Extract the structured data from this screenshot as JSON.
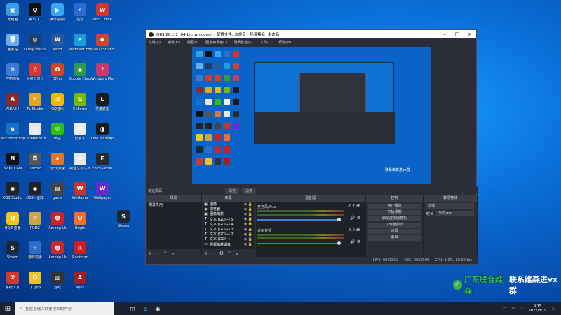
{
  "desktop_icons": [
    {
      "label": "此电脑",
      "color": "#3a9de0",
      "glyph": "▣"
    },
    {
      "label": "腾讯QQ",
      "color": "#111111",
      "glyph": "Q"
    },
    {
      "label": "腾讯视频",
      "color": "#39a6f5",
      "glyph": "▶"
    },
    {
      "label": "迅雷",
      "color": "#2c6bd6",
      "glyph": "⚡"
    },
    {
      "label": "WPS Office",
      "color": "#d8322c",
      "glyph": "W"
    },
    {
      "label": "回收站",
      "color": "#6aaee6",
      "glyph": "🗑"
    },
    {
      "label": "Lively Wallpaper",
      "color": "#223b6a",
      "glyph": "◎"
    },
    {
      "label": "Word",
      "color": "#2b579a",
      "glyph": "W"
    },
    {
      "label": "Microsoft Edge",
      "color": "#1a9dd9",
      "glyph": "e"
    },
    {
      "label": "Visual Studio",
      "color": "#d6402c",
      "glyph": "◆"
    },
    {
      "label": "控制面板",
      "color": "#3e7ad0",
      "glyph": "⚙"
    },
    {
      "label": "网易云音乐",
      "color": "#d33a31",
      "glyph": "♫"
    },
    {
      "label": "Office",
      "color": "#d0452a",
      "glyph": "O"
    },
    {
      "label": "Google Chrome",
      "color": "#2e9a4a",
      "glyph": "◉"
    },
    {
      "label": "Windows Media",
      "color": "#c73a6a",
      "glyph": "♪"
    },
    {
      "label": "AIDA64",
      "color": "#8a2a2a",
      "glyph": "A"
    },
    {
      "label": "FL Studio",
      "color": "#e3a623",
      "glyph": "F"
    },
    {
      "label": "QQ音乐",
      "color": "#f2b705",
      "glyph": "♬"
    },
    {
      "label": "GeForce",
      "color": "#76b900",
      "glyph": "G"
    },
    {
      "label": "英雄联盟",
      "color": "#1c1c1c",
      "glyph": "L"
    },
    {
      "label": "Microsoft Edge",
      "color": "#1572c7",
      "glyph": "e"
    },
    {
      "label": "Counter-Strike",
      "color": "#e8e8e8",
      "glyph": "C"
    },
    {
      "label": "微信",
      "color": "#2dc100",
      "glyph": "✆"
    },
    {
      "label": "记事本",
      "color": "#ededed",
      "glyph": "≡"
    },
    {
      "label": "Live Wallpaper",
      "color": "#1b1b1b",
      "glyph": "◑"
    },
    {
      "label": "NZXT CAM",
      "color": "#111111",
      "glyph": "N"
    },
    {
      "label": "Discord",
      "color": "#555555",
      "glyph": "◘"
    },
    {
      "label": "游戏加速",
      "color": "#e0762a",
      "glyph": "★"
    },
    {
      "label": "新建文本文档",
      "color": "#e8e8e8",
      "glyph": "≡"
    },
    {
      "label": "Epic Games",
      "color": "#2a2a2a",
      "glyph": "E"
    },
    {
      "label": "OBS Studio",
      "color": "#222222",
      "glyph": "◉"
    },
    {
      "label": "OBS - 副本",
      "color": "#222222",
      "glyph": "◉"
    },
    {
      "label": "game",
      "color": "#444444",
      "glyph": "▤"
    },
    {
      "label": "WeGame",
      "color": "#c8332a",
      "glyph": "W"
    },
    {
      "label": "Wallpaper",
      "color": "#6a2ad0",
      "glyph": "W"
    },
    {
      "label": "QQ浏览器",
      "color": "#f3c81a",
      "glyph": "Q"
    },
    {
      "label": "PUBG",
      "color": "#c9a449",
      "glyph": "P"
    },
    {
      "label": "Among Us",
      "color": "#cc2222",
      "glyph": "☻"
    },
    {
      "label": "Origin",
      "color": "#f56c2d",
      "glyph": "O"
    },
    {
      "label": "",
      "color": "transparent",
      "glyph": ""
    },
    {
      "label": "Steam",
      "color": "#1b2838",
      "glyph": "S"
    },
    {
      "label": "游戏助手",
      "color": "#2f6ec6",
      "glyph": "☆"
    },
    {
      "label": "Among Us",
      "color": "#c62b2b",
      "glyph": "☻"
    },
    {
      "label": "Rockstar",
      "color": "#d01c1c",
      "glyph": "R"
    },
    {
      "label": "",
      "color": "transparent",
      "glyph": ""
    },
    {
      "label": "系统工具",
      "color": "#d13b2b",
      "glyph": "⚒"
    },
    {
      "label": "QQ游戏",
      "color": "#f1c02a",
      "glyph": "Q"
    },
    {
      "label": "游戏",
      "color": "#333333",
      "glyph": "▥"
    },
    {
      "label": "Apex",
      "color": "#a01f1f",
      "glyph": "A"
    },
    {
      "label": "",
      "color": "transparent",
      "glyph": ""
    }
  ],
  "steam_extra": {
    "label": "Steam",
    "color": "#1b2838",
    "glyph": "S"
  },
  "obs": {
    "title": "OBS 26.1.1 (64-bit, windows) - 配置文件: 未命名 - 场景集合: 未命名",
    "menu": [
      "文件(F)",
      "编辑(E)",
      "视图(V)",
      "固定停靠窗口",
      "场景集合(S)",
      "工具(T)",
      "帮助(H)"
    ],
    "preview_badge": "联系维森进vx群",
    "no_source_label": "未选择源",
    "btn_properties": "属性",
    "btn_filters": "滤镜",
    "docks": {
      "scenes_title": "场景",
      "sources_title": "来源",
      "mixer_title": "混音器",
      "transitions_title": "转场特效",
      "controls_title": "控制"
    },
    "scenes": [
      "場景专用"
    ],
    "sources": [
      {
        "icon": "▣",
        "name": "图像"
      },
      {
        "icon": "◉",
        "name": "浏览器"
      },
      {
        "icon": "▣",
        "name": "图像捕获"
      },
      {
        "icon": "T",
        "name": "文本 (GDI+) 5"
      },
      {
        "icon": "T",
        "name": "文本 (GDI+) 4"
      },
      {
        "icon": "T",
        "name": "文本 (GDI+) 3"
      },
      {
        "icon": "T",
        "name": "文本 (GDI+) 2"
      },
      {
        "icon": "T",
        "name": "文本 (GDI+)"
      },
      {
        "icon": "▭",
        "name": "视频捕获设备"
      }
    ],
    "mixer": [
      {
        "name": "麦克风/Aux",
        "db": "-0.7 dB"
      },
      {
        "name": "桌面音频",
        "db": "-0.0 dB"
      }
    ],
    "transition": {
      "type": "淡出",
      "duration_label": "时长",
      "duration": "300 ms"
    },
    "controls": [
      "停止推流",
      "开始录制",
      "启动虚拟摄像机",
      "工作室模式",
      "设置",
      "退出"
    ],
    "status": {
      "live": "LIVE: 00:00:00",
      "rec": "REC: 00:00:00",
      "cpu": "CPU: 1.0%, 60.00 fps"
    }
  },
  "watermark": {
    "green": "广东联合维森",
    "white": "联系维森进vx群"
  },
  "taskbar": {
    "search_placeholder": "在这里输入你要搜索的内容",
    "time": "9:15",
    "date": "2022/8/19"
  }
}
